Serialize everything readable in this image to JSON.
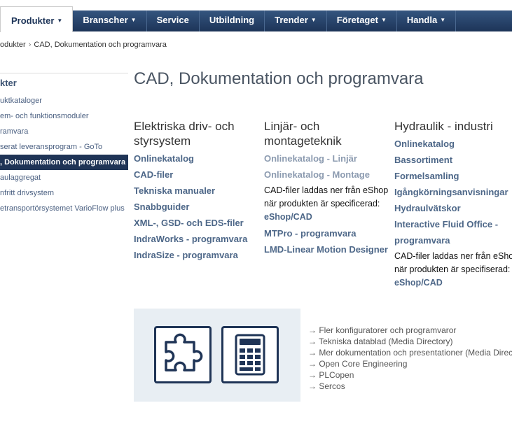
{
  "nav": {
    "items": [
      {
        "label": "Produkter",
        "caret": true,
        "active": true
      },
      {
        "label": "Branscher",
        "caret": true
      },
      {
        "label": "Service"
      },
      {
        "label": "Utbildning"
      },
      {
        "label": "Trender",
        "caret": true
      },
      {
        "label": "Företaget",
        "caret": true
      },
      {
        "label": "Handla",
        "caret": true
      }
    ]
  },
  "breadcrumb": {
    "items": [
      "odukter",
      "CAD, Dokumentation och programvara"
    ],
    "separator": "›"
  },
  "sidebar": {
    "heading": "kter",
    "items": [
      "uktkataloger",
      "em- och funktionsmoduler",
      "ramvara",
      "serat leveransprogram - GoTo",
      ", Dokumentation och programvara",
      "aulaggregat",
      "nfritt drivsystem",
      "etransportörsystemet VarioFlow plus"
    ],
    "selected": 4
  },
  "page": {
    "title": "CAD, Dokumentation och programvara"
  },
  "columns": [
    {
      "heading": "Elektriska driv- och styrsystem",
      "entries": [
        {
          "link": "Onlinekatalog"
        },
        {
          "link": "CAD-filer"
        },
        {
          "link": "Tekniska manualer"
        },
        {
          "link": "Snabbguider"
        },
        {
          "link": "XML-, GSD- och EDS-filer"
        },
        {
          "link": "IndraWorks - programvara"
        },
        {
          "link": "IndraSize - programvara"
        }
      ]
    },
    {
      "heading": "Linjär- och montageteknik",
      "entries": [
        {
          "link": "Onlinekatalog - Linjär",
          "muted": true
        },
        {
          "link": "Onlinekatalog - Montage",
          "muted": true
        },
        {
          "text": "CAD-filer laddas ner från eShop när produkten är specificerad: ",
          "text_link": "eShop/CAD"
        },
        {
          "link": "MTPro - programvara"
        },
        {
          "link": "LMD-Linear Motion Designer"
        }
      ]
    },
    {
      "heading": "Hydraulik - industri",
      "entries": [
        {
          "link": "Onlinekatalog"
        },
        {
          "link": "Bassortiment"
        },
        {
          "link": "Formelsamling"
        },
        {
          "link": "Igångkörningsanvisningar"
        },
        {
          "link": "Hydraulvätskor"
        },
        {
          "link": "Interactive Fluid Office - programvara"
        },
        {
          "text": "CAD-filer laddas ner från eShop när produkten är specifiserad: ",
          "text_link": "eShop/CAD"
        }
      ]
    }
  ],
  "more_links": {
    "arrow": "→",
    "items": [
      "Fler konfiguratorer och programvaror",
      "Tekniska datablad (Media Directory)",
      "Mer dokumentation och presentationer (Media Directory)",
      "Open Core Engineering",
      "PLCopen",
      "Sercos"
    ]
  },
  "icons": [
    "puzzle-icon",
    "calculator-icon"
  ],
  "colors": {
    "nav": "#1d3458",
    "link": "#4d6788",
    "muted_link": "#8c9bb0",
    "box": "#e8eef3"
  }
}
